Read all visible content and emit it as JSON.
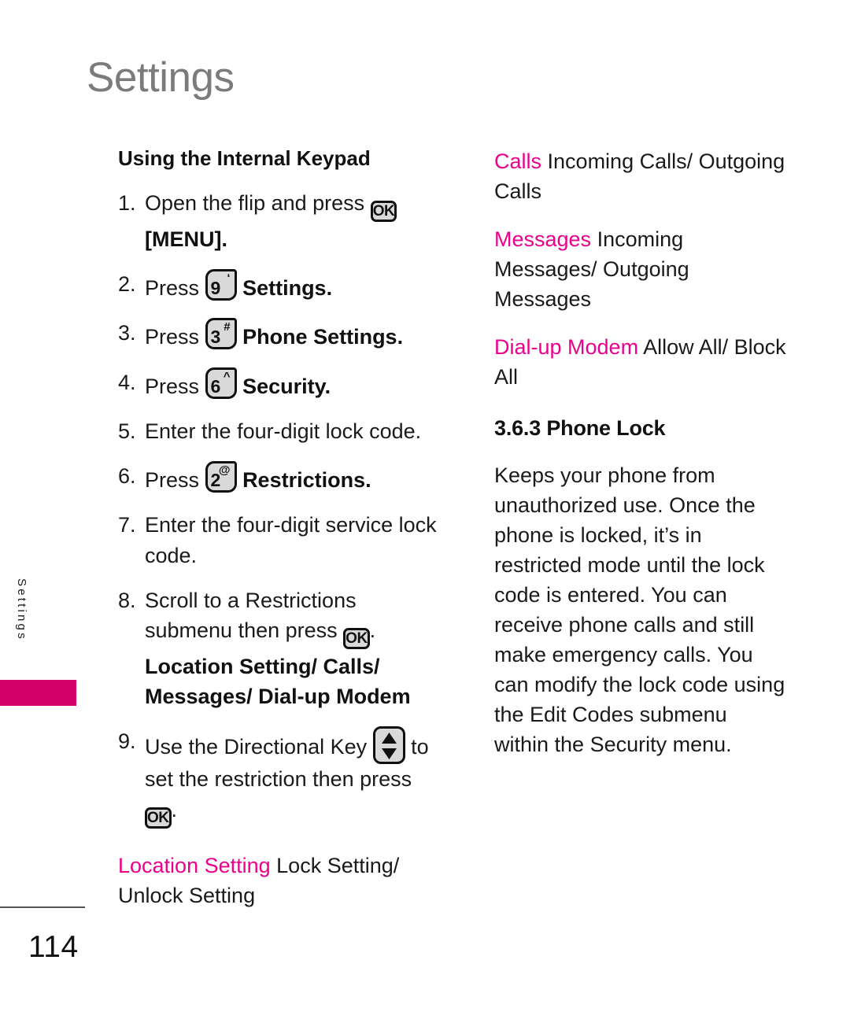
{
  "page": {
    "chapter_title": "Settings",
    "side_tab_label": "Settings",
    "page_number": "114",
    "accent_magenta": "#ec008c",
    "tab_magenta": "#d4006a",
    "title_gray": "#7b7b7b"
  },
  "left_column": {
    "heading": "Using the Internal Keypad",
    "steps": [
      {
        "num": "1.",
        "text_before": "Open the flip and press",
        "icon": "ok-key-icon",
        "icon_label": "OK",
        "text_after_bold": "[MENU]",
        "text_after": "."
      },
      {
        "num": "2.",
        "text_before": "Press",
        "icon": "number-key-9-icon",
        "key_digit": "9",
        "key_symbol": "‘",
        "text_after_bold": "Settings",
        "text_after": "."
      },
      {
        "num": "3.",
        "text_before": "Press",
        "icon": "number-key-3-icon",
        "key_digit": "3",
        "key_symbol": "#",
        "text_after_bold": "Phone Settings",
        "text_after": "."
      },
      {
        "num": "4.",
        "text_before": "Press",
        "icon": "number-key-6-icon",
        "key_digit": "6",
        "key_symbol": "^",
        "text_after_bold": "Security",
        "text_after": "."
      },
      {
        "num": "5.",
        "text_before": "Enter the four-digit lock code.",
        "icon": null
      },
      {
        "num": "6.",
        "text_before": "Press",
        "icon": "number-key-2-icon",
        "key_digit": "2",
        "key_symbol": "@",
        "text_after_bold": "Restrictions",
        "text_after": "."
      },
      {
        "num": "7.",
        "text_before": "Enter the four-digit service lock code.",
        "icon": null
      },
      {
        "num": "8.",
        "text_before": "Scroll to a Restrictions submenu then press",
        "icon": "ok-key-icon",
        "icon_label": "OK",
        "text_after": ".",
        "bold_block": "Location Setting/ Calls/ Messages/ Dial-up Modem"
      },
      {
        "num": "9.",
        "text_before": "Use the Directional Key",
        "icon": "directional-key-icon",
        "text_mid": "to set the restriction then press",
        "icon2": "ok-key-icon",
        "icon2_label": "OK",
        "text_after": "."
      }
    ],
    "note": {
      "accent_text": "Location Setting",
      "rest_text": "Lock Setting/ Unlock Setting"
    }
  },
  "right_column": {
    "options": [
      {
        "accent_text": "Calls",
        "rest_text": "Incoming Calls/ Outgoing Calls"
      },
      {
        "accent_text": "Messages",
        "rest_text": "Incoming Messages/ Outgoing Messages"
      },
      {
        "accent_text": "Dial-up Modem",
        "rest_text": "Allow All/ Block All"
      }
    ],
    "section_heading": "3.6.3 Phone Lock",
    "body": "Keeps your phone from unauthorized use. Once the phone is locked, it’s in restricted mode until the lock code is entered. You can receive phone calls and still make emergency calls. You can modify the lock code using the Edit Codes submenu within the Security menu."
  }
}
